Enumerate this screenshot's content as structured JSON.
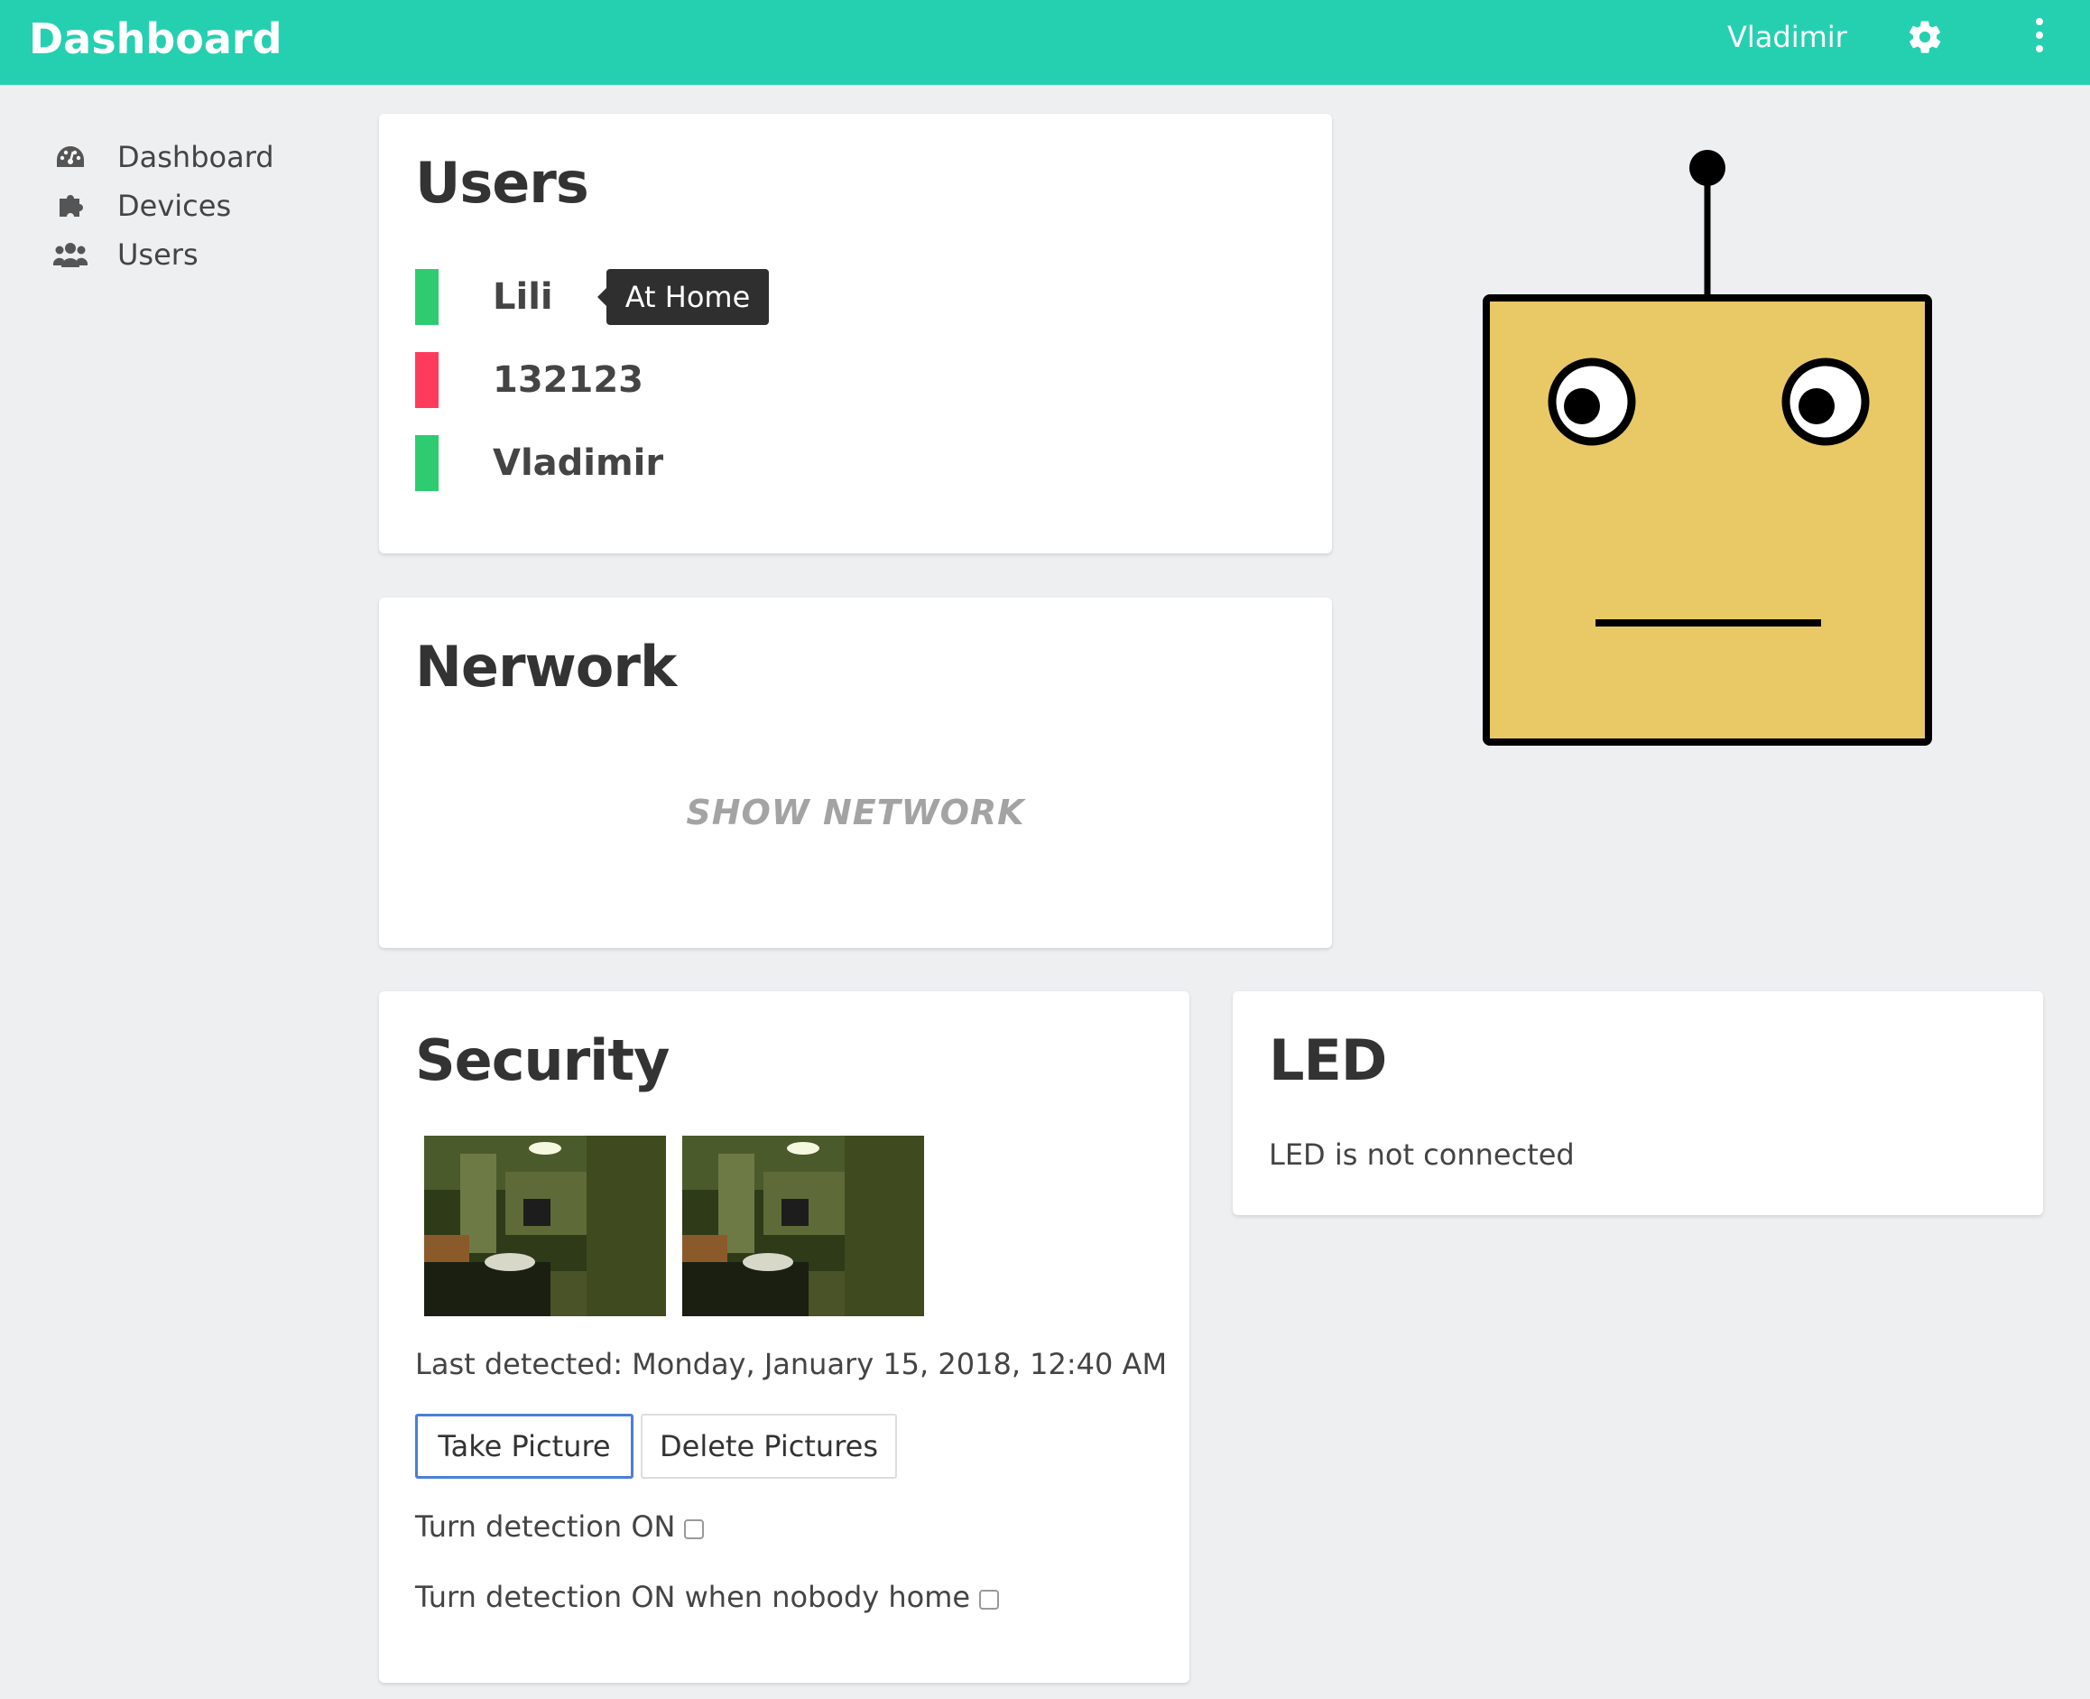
{
  "header": {
    "title": "Dashboard",
    "user_name": "Vladimir",
    "settings_icon": "gear-icon",
    "menu_icon": "kebab-menu-icon",
    "accent_color": "#25d0b1"
  },
  "sidebar": {
    "items": [
      {
        "label": "Dashboard",
        "icon": "dashboard-icon"
      },
      {
        "label": "Devices",
        "icon": "puzzle-icon"
      },
      {
        "label": "Users",
        "icon": "users-icon"
      }
    ]
  },
  "users_card": {
    "title": "Users",
    "users": [
      {
        "name": "Lili",
        "status_color": "#2ecc71"
      },
      {
        "name": "132123",
        "status_color": "#ff3b5c"
      },
      {
        "name": "Vladimir",
        "status_color": "#2ecc71"
      }
    ],
    "tooltip": "At Home"
  },
  "network_card": {
    "title": "Nerwork",
    "show_button": "SHOW NETWORK"
  },
  "security_card": {
    "title": "Security",
    "last_detected": "Last detected: Monday, January 15, 2018, 12:40 AM",
    "take_picture_label": "Take Picture",
    "delete_pictures_label": "Delete Pictures",
    "detection_on_label": "Turn detection ON",
    "detection_nobody_label": "Turn detection ON when nobody home"
  },
  "led_card": {
    "title": "LED",
    "status": "LED is not connected"
  }
}
